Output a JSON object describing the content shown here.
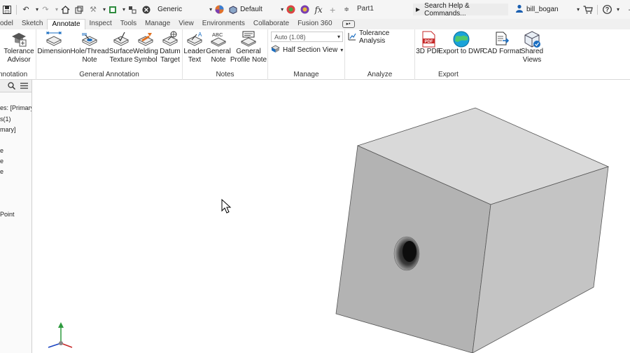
{
  "qat": {
    "appearance_value": "Generic",
    "material_value": "Default",
    "document_title": "Part1",
    "search_placeholder": "Search Help & Commands...",
    "user_name": "bill_bogan"
  },
  "tabs": [
    "odel",
    "Sketch",
    "Annotate",
    "Inspect",
    "Tools",
    "Manage",
    "View",
    "Environments",
    "Collaborate",
    "Fusion 360"
  ],
  "ribbon": {
    "tolerance_advisor": {
      "line1": "Tolerance",
      "line2": "Advisor",
      "panel": "nnotation"
    },
    "general_annotation": {
      "title": "General Annotation",
      "buttons": [
        {
          "line1": "Dimension",
          "line2": ""
        },
        {
          "line1": "Hole/Thread",
          "line2": "Note"
        },
        {
          "line1": "Surface",
          "line2": "Texture"
        },
        {
          "line1": "Welding",
          "line2": "Symbol"
        },
        {
          "line1": "Datum",
          "line2": "Target"
        }
      ]
    },
    "notes": {
      "title": "Notes",
      "buttons": [
        {
          "line1": "Leader",
          "line2": "Text"
        },
        {
          "line1": "General",
          "line2": "Note"
        },
        {
          "line1": "General",
          "line2": "Profile Note"
        }
      ]
    },
    "manage": {
      "title": "Manage",
      "scale_value": "Auto (1.08)",
      "section_view_label": "Half Section View"
    },
    "analyze": {
      "title": "Analyze",
      "tolerance_analysis_label": "Tolerance Analysis"
    },
    "export": {
      "title": "Export",
      "buttons": [
        {
          "line1": "3D PDF",
          "line2": ""
        },
        {
          "line1": "Export to DWF",
          "line2": ""
        },
        {
          "line1": "CAD Format",
          "line2": ""
        },
        {
          "line1": "Shared",
          "line2": "Views"
        }
      ]
    }
  },
  "browser": {
    "items": [
      "es: [Primary]",
      "s(1)",
      "mary]",
      "e",
      "e",
      "e",
      "Point"
    ]
  },
  "colors": {
    "accent_blue": "#1a6ec2",
    "cube_front": "#b3b3b3",
    "cube_top": "#d9d9d9",
    "cube_right": "#c4c4c4"
  }
}
